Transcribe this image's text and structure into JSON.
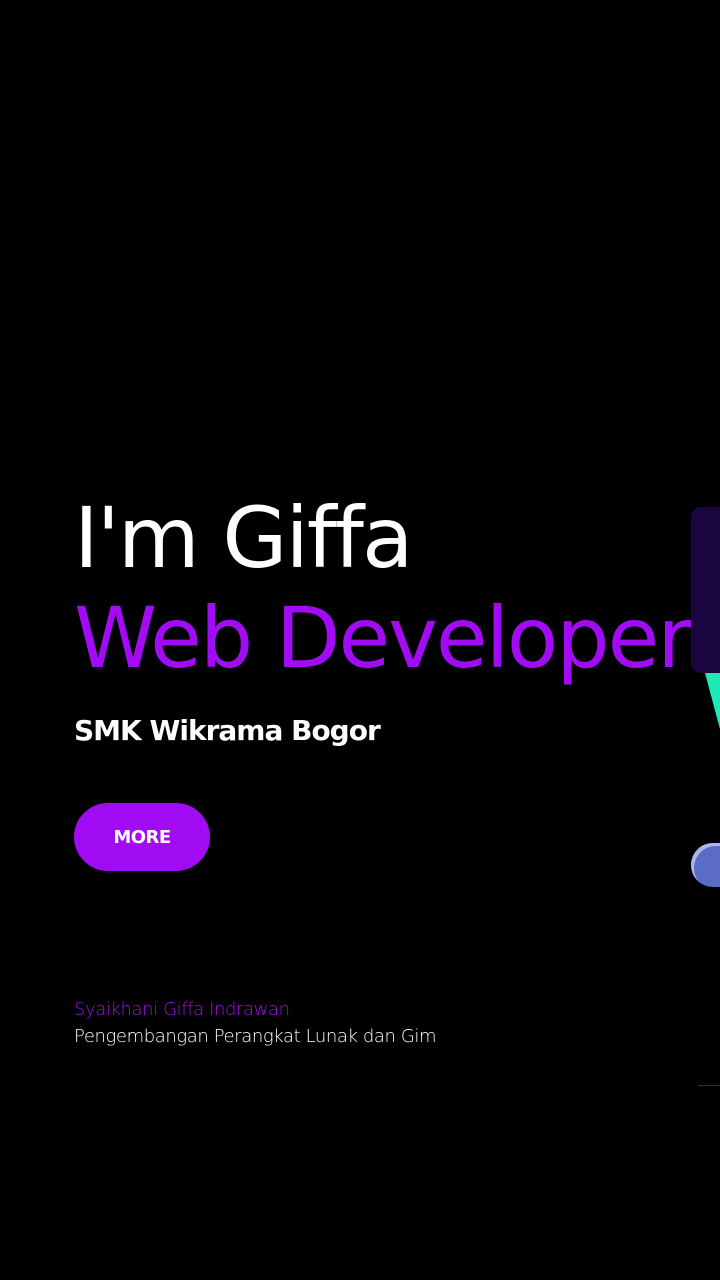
{
  "hero": {
    "greeting": "I'm Giffa",
    "role": "Web Developer",
    "school": "SMK Wikrama Bogor",
    "more_label": "MORE"
  },
  "footer": {
    "name": "Syaikhani Giffa Indrawan",
    "major": "Pengembangan Perangkat Lunak dan Gim"
  },
  "colors": {
    "background": "#000000",
    "accent": "#a10cf4",
    "text": "#ffffff"
  }
}
